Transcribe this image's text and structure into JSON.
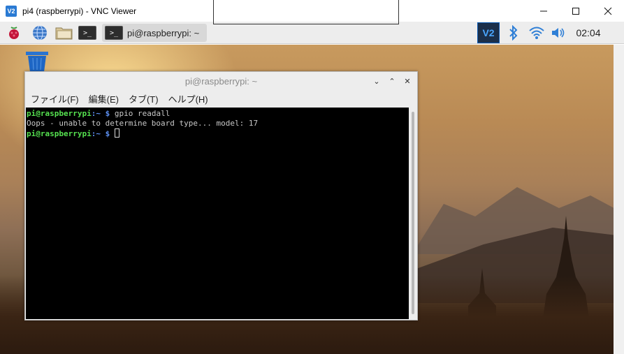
{
  "window": {
    "title": "pi4 (raspberrypi) - VNC Viewer",
    "logo": "V2"
  },
  "panel": {
    "task_label": "pi@raspberrypi: ~",
    "clock": "02:04",
    "vnc_tray_label": "V2",
    "term_icon_glyph": ">_"
  },
  "terminal": {
    "title": "pi@raspberrypi: ~",
    "menu": [
      "ファイル(F)",
      "編集(E)",
      "タブ(T)",
      "ヘルプ(H)"
    ],
    "lines": [
      {
        "user": "pi@raspberrypi",
        "path": ":~",
        "prompt": " $ ",
        "command": "gpio readall"
      },
      {
        "output": "Oops - unable to determine board type... model: 17"
      },
      {
        "user": "pi@raspberrypi",
        "path": ":~",
        "prompt": " $ ",
        "command": ""
      }
    ]
  }
}
